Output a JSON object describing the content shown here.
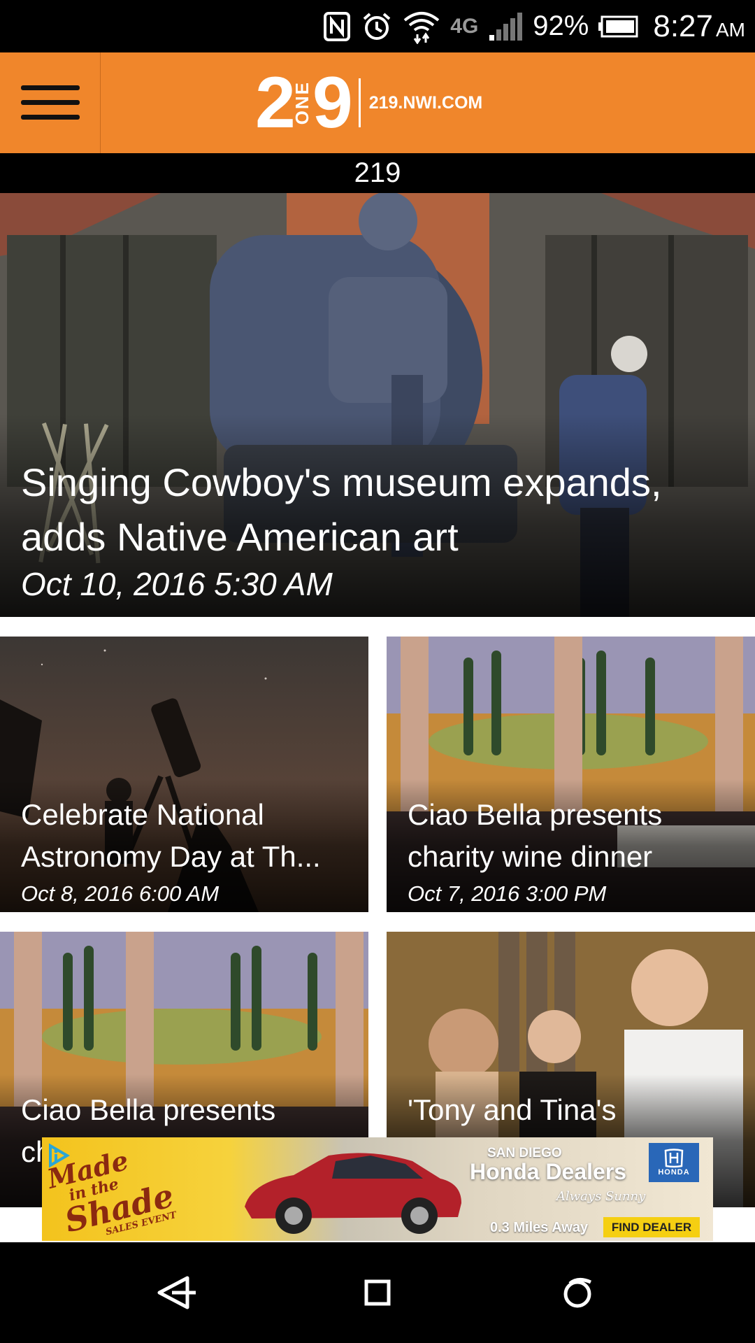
{
  "status_bar": {
    "icons": [
      "nfc-icon",
      "alarm-icon",
      "wifi-icon",
      "lte-icon",
      "signal-icon",
      "battery-icon"
    ],
    "network_label": "4G",
    "battery_percent": "92%",
    "time": "8:27",
    "ampm": "AM"
  },
  "header": {
    "menu_icon": "hamburger-menu-icon",
    "logo": {
      "number_left": "2",
      "number_middle": "ONE",
      "number_right": "9",
      "domain": "219.NWI.COM"
    },
    "accent_color": "#f0862b"
  },
  "section": {
    "title": "219"
  },
  "hero": {
    "headline": "Singing Cowboy's museum expands, adds Native American art",
    "date": "Oct 10, 2016 5:30 AM"
  },
  "cards": [
    {
      "title": "Celebrate National Astronomy Day at Th...",
      "date": "Oct 8, 2016 6:00 AM"
    },
    {
      "title": "Ciao Bella presents charity wine dinner",
      "date": "Oct 7, 2016 3:00 PM"
    },
    {
      "title": "Ciao Bella presents charity wine dinner",
      "date": ""
    },
    {
      "title": "'Tony and Tina's Wedding' offers fun for",
      "date": ""
    }
  ],
  "ad": {
    "promo_lines": [
      "Made",
      "in the",
      "Shade",
      "SALES EVENT"
    ],
    "dealer_city": "SAN DIEGO",
    "dealer_name": "Honda Dealers",
    "tagline": "Always Sunny",
    "distance": "0.3 Miles Away",
    "cta": "FIND DEALER",
    "brand": "HONDA"
  },
  "nav": {
    "back_icon": "back-triangle-icon",
    "home_icon": "home-square-icon",
    "recents_icon": "recents-circle-icon"
  }
}
